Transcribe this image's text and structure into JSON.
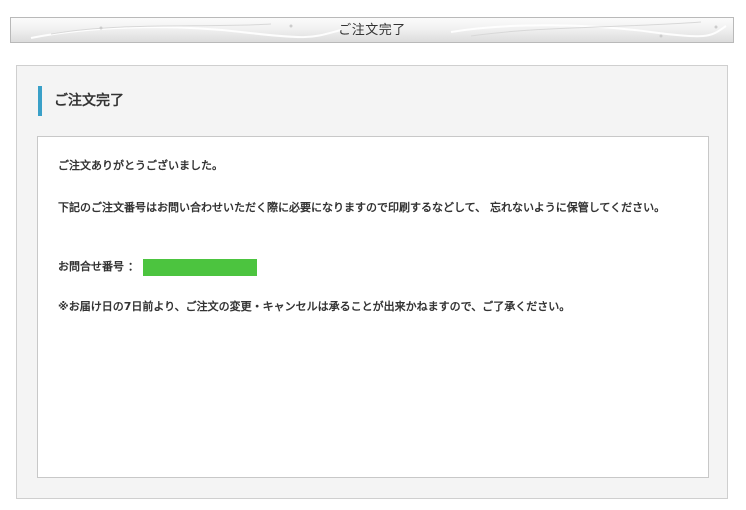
{
  "header": {
    "title": "ご注文完了"
  },
  "section": {
    "heading": "ご注文完了"
  },
  "messages": {
    "thanks": "ご注文ありがとうございました。",
    "keep_notice": "下記のご注文番号はお問い合わせいただく際に必要になりますので印刷するなどして、 忘れないように保管してください。",
    "order_label": "お問合せ番号 ：",
    "order_number": "",
    "cancel_notice": "※お届け日の7日前より、ご注文の変更・キャンセルは承ることが出来かねますので、ご了承ください。"
  },
  "colors": {
    "accent": "#3aa0c8",
    "order_number_highlight": "#4cc43f"
  }
}
